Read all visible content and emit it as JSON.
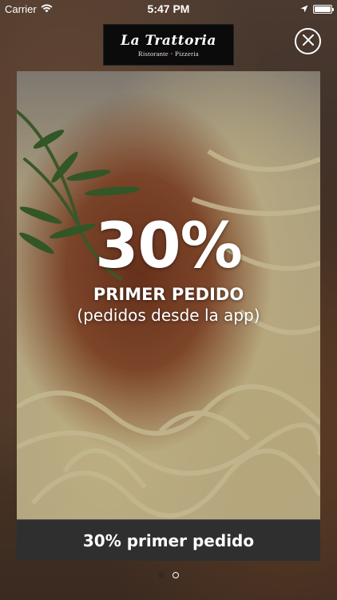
{
  "status_bar": {
    "carrier": "Carrier",
    "time": "5:47 PM"
  },
  "logo": {
    "title": "La Trattoria",
    "subtitle_left": "Ristorante",
    "subtitle_separator": "•",
    "subtitle_right": "Pizzeria"
  },
  "promo": {
    "percent": "30%",
    "headline": "PRIMER PEDIDO",
    "subline": "(pedidos desde la app)",
    "caption": "30% primer pedido"
  },
  "pagination": {
    "total": 2,
    "active_index": 1
  },
  "colors": {
    "caption_bg": "#2f2f2f",
    "logo_bg": "#0b0b0b"
  },
  "icons": [
    "wifi-icon",
    "location-arrow-icon",
    "battery-icon",
    "close-icon"
  ]
}
